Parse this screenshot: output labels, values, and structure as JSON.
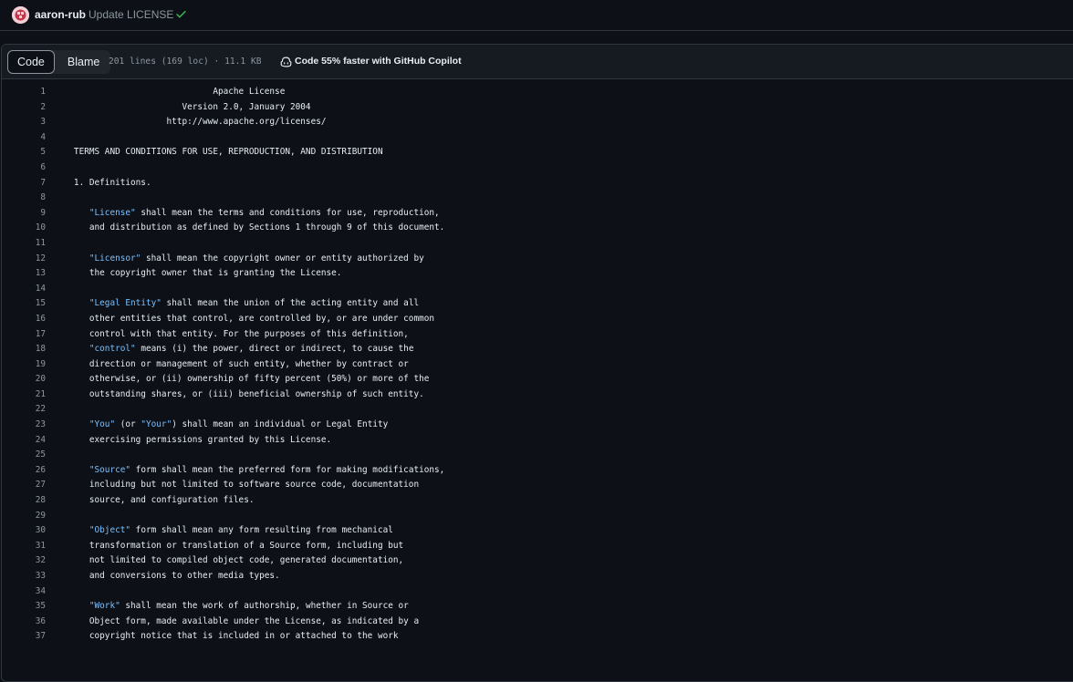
{
  "commit": {
    "author": "aaron-rub",
    "message": "Update LICENSE"
  },
  "file_header": {
    "code_tab": "Code",
    "blame_tab": "Blame",
    "meta": "201 lines (169 loc) · 11.1 KB",
    "copilot_promo": "Code 55% faster with GitHub Copilot"
  },
  "colors": {
    "background": "#0d1117",
    "header": "#161b22",
    "border": "#30363d",
    "text": "#e6edf3",
    "muted": "#8d96a0",
    "quoted": "#79c0ff",
    "success": "#3fb950"
  },
  "lines": [
    {
      "n": "1",
      "text": "                              Apache License"
    },
    {
      "n": "2",
      "text": "                        Version 2.0, January 2004"
    },
    {
      "n": "3",
      "text": "                     http://www.apache.org/licenses/"
    },
    {
      "n": "4",
      "text": ""
    },
    {
      "n": "5",
      "text": "   TERMS AND CONDITIONS FOR USE, REPRODUCTION, AND DISTRIBUTION"
    },
    {
      "n": "6",
      "text": ""
    },
    {
      "n": "7",
      "text": "   1. Definitions."
    },
    {
      "n": "8",
      "text": ""
    },
    {
      "n": "9",
      "text": "      \"License\" shall mean the terms and conditions for use, reproduction,"
    },
    {
      "n": "10",
      "text": "      and distribution as defined by Sections 1 through 9 of this document."
    },
    {
      "n": "11",
      "text": ""
    },
    {
      "n": "12",
      "text": "      \"Licensor\" shall mean the copyright owner or entity authorized by"
    },
    {
      "n": "13",
      "text": "      the copyright owner that is granting the License."
    },
    {
      "n": "14",
      "text": ""
    },
    {
      "n": "15",
      "text": "      \"Legal Entity\" shall mean the union of the acting entity and all"
    },
    {
      "n": "16",
      "text": "      other entities that control, are controlled by, or are under common"
    },
    {
      "n": "17",
      "text": "      control with that entity. For the purposes of this definition,"
    },
    {
      "n": "18",
      "text": "      \"control\" means (i) the power, direct or indirect, to cause the"
    },
    {
      "n": "19",
      "text": "      direction or management of such entity, whether by contract or"
    },
    {
      "n": "20",
      "text": "      otherwise, or (ii) ownership of fifty percent (50%) or more of the"
    },
    {
      "n": "21",
      "text": "      outstanding shares, or (iii) beneficial ownership of such entity."
    },
    {
      "n": "22",
      "text": ""
    },
    {
      "n": "23",
      "text": "      \"You\" (or \"Your\") shall mean an individual or Legal Entity"
    },
    {
      "n": "24",
      "text": "      exercising permissions granted by this License."
    },
    {
      "n": "25",
      "text": ""
    },
    {
      "n": "26",
      "text": "      \"Source\" form shall mean the preferred form for making modifications,"
    },
    {
      "n": "27",
      "text": "      including but not limited to software source code, documentation"
    },
    {
      "n": "28",
      "text": "      source, and configuration files."
    },
    {
      "n": "29",
      "text": ""
    },
    {
      "n": "30",
      "text": "      \"Object\" form shall mean any form resulting from mechanical"
    },
    {
      "n": "31",
      "text": "      transformation or translation of a Source form, including but"
    },
    {
      "n": "32",
      "text": "      not limited to compiled object code, generated documentation,"
    },
    {
      "n": "33",
      "text": "      and conversions to other media types."
    },
    {
      "n": "34",
      "text": ""
    },
    {
      "n": "35",
      "text": "      \"Work\" shall mean the work of authorship, whether in Source or"
    },
    {
      "n": "36",
      "text": "      Object form, made available under the License, as indicated by a"
    },
    {
      "n": "37",
      "text": "      copyright notice that is included in or attached to the work"
    }
  ]
}
